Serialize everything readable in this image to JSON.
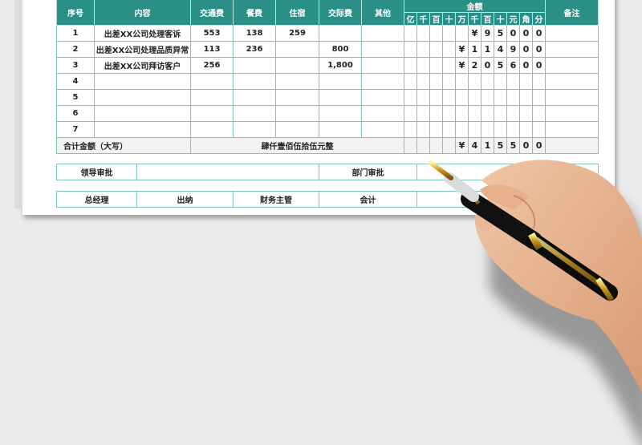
{
  "headers": {
    "seq": "序号",
    "content": "内容",
    "transport": "交通费",
    "meals": "餐费",
    "lodging": "住宿",
    "entertainment": "交际费",
    "other": "其他",
    "amount": "金额",
    "remarks": "备注",
    "digits": [
      "亿",
      "千",
      "百",
      "十",
      "万",
      "千",
      "百",
      "十",
      "元",
      "角",
      "分"
    ]
  },
  "rows": [
    {
      "seq": "1",
      "content": "出差XX公司处理客诉",
      "transport": "553",
      "meals": "138",
      "lodging": "259",
      "entertainment": "",
      "other": "",
      "digits": [
        "",
        "",
        "",
        "",
        "",
        "¥",
        "9",
        "5",
        "0",
        "0",
        "0"
      ],
      "remarks": ""
    },
    {
      "seq": "2",
      "content": "出差XX公司处理品质异常",
      "transport": "113",
      "meals": "236",
      "lodging": "",
      "entertainment": "800",
      "other": "",
      "digits": [
        "",
        "",
        "",
        "",
        "¥",
        "1",
        "1",
        "4",
        "9",
        "0",
        "0"
      ],
      "remarks": ""
    },
    {
      "seq": "3",
      "content": "出差XX公司拜访客户",
      "transport": "256",
      "meals": "",
      "lodging": "",
      "entertainment": "1,800",
      "other": "",
      "digits": [
        "",
        "",
        "",
        "",
        "¥",
        "2",
        "0",
        "5",
        "6",
        "0",
        "0"
      ],
      "remarks": ""
    },
    {
      "seq": "4",
      "content": "",
      "transport": "",
      "meals": "",
      "lodging": "",
      "entertainment": "",
      "other": "",
      "digits": [
        "",
        "",
        "",
        "",
        "",
        "",
        "",
        "",
        "",
        "",
        ""
      ],
      "remarks": ""
    },
    {
      "seq": "5",
      "content": "",
      "transport": "",
      "meals": "",
      "lodging": "",
      "entertainment": "",
      "other": "",
      "digits": [
        "",
        "",
        "",
        "",
        "",
        "",
        "",
        "",
        "",
        "",
        ""
      ],
      "remarks": ""
    },
    {
      "seq": "6",
      "content": "",
      "transport": "",
      "meals": "",
      "lodging": "",
      "entertainment": "",
      "other": "",
      "digits": [
        "",
        "",
        "",
        "",
        "",
        "",
        "",
        "",
        "",
        "",
        ""
      ],
      "remarks": ""
    },
    {
      "seq": "7",
      "content": "",
      "transport": "",
      "meals": "",
      "lodging": "",
      "entertainment": "",
      "other": "",
      "digits": [
        "",
        "",
        "",
        "",
        "",
        "",
        "",
        "",
        "",
        "",
        ""
      ],
      "remarks": ""
    }
  ],
  "total": {
    "label": "合计金额（大写）",
    "words": "肆仟壹佰伍拾伍元整",
    "digits": [
      "",
      "",
      "",
      "",
      "¥",
      "4",
      "1",
      "5",
      "5",
      "0",
      "0"
    ]
  },
  "approval": {
    "leader": "领导审批",
    "department": "部门审批"
  },
  "signatures": [
    "总经理",
    "出纳",
    "财务主管",
    "会计",
    "领款人"
  ],
  "colors": {
    "header": "#2a8f86",
    "border": "#7fc4bd"
  }
}
